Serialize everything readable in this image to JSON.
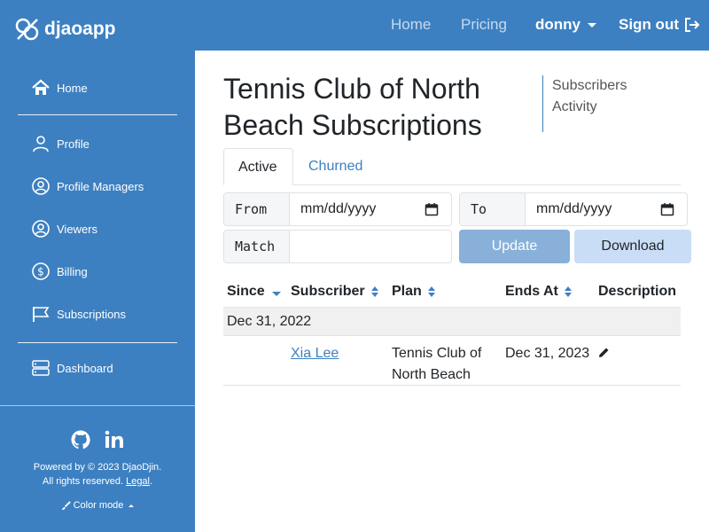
{
  "brand": {
    "name": "djaoapp"
  },
  "nav": {
    "home": "Home",
    "pricing": "Pricing",
    "user": "donny",
    "signout": "Sign out"
  },
  "sidebar": {
    "items": [
      {
        "label": "Home"
      },
      {
        "label": "Profile"
      },
      {
        "label": "Profile Managers"
      },
      {
        "label": "Viewers"
      },
      {
        "label": "Billing"
      },
      {
        "label": "Subscriptions"
      },
      {
        "label": "Dashboard"
      }
    ],
    "footer": {
      "powered_line1": "Powered by © 2023 DjaoDjin.",
      "powered_line2": "All rights reserved.",
      "legal": "Legal",
      "period": ".",
      "color_mode": "Color mode"
    }
  },
  "main": {
    "title": "Tennis Club of North Beach Subscriptions",
    "side_links": [
      "Subscribers",
      "Activity"
    ],
    "tabs": [
      {
        "label": "Active",
        "active": true
      },
      {
        "label": "Churned",
        "active": false
      }
    ],
    "filters": {
      "from_label": "From",
      "from_value": "mm/dd/yyyy",
      "to_label": "To",
      "to_value": "mm/dd/yyyy",
      "match_label": "Match",
      "match_value": ""
    },
    "buttons": {
      "update": "Update",
      "download": "Download"
    },
    "table": {
      "columns": [
        "Since",
        "Subscriber",
        "Plan",
        "Ends At",
        "Description"
      ],
      "groups": [
        {
          "date": "Dec 31, 2022",
          "rows": [
            {
              "subscriber": "Xia Lee",
              "plan": "Tennis Club of North Beach",
              "ends_at": "Dec 31, 2023"
            }
          ]
        }
      ]
    }
  },
  "colors": {
    "primary": "#3d80c1",
    "update_button": "#88b0d9",
    "download_button": "#c9ddf6"
  }
}
